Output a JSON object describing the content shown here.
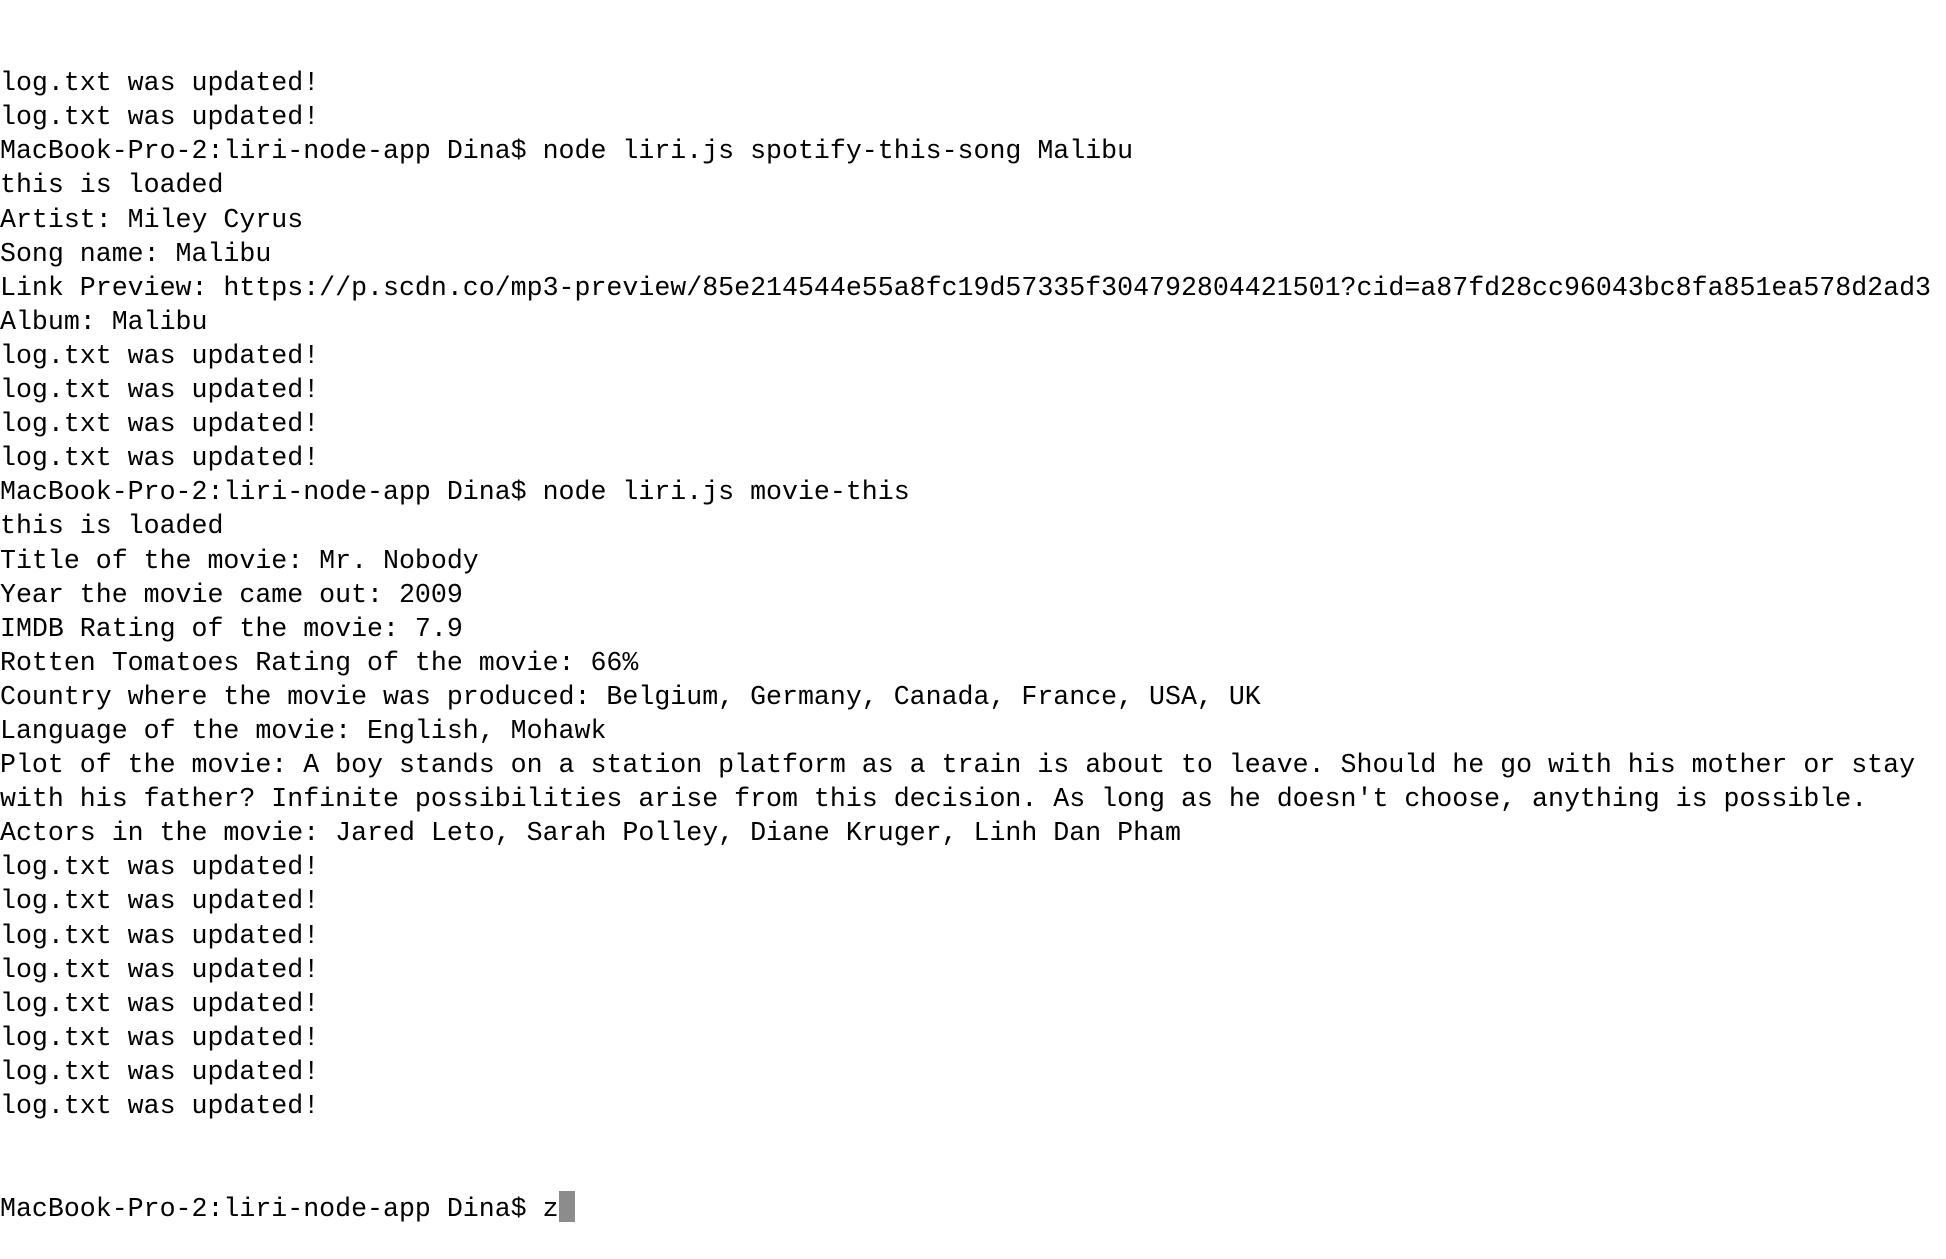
{
  "terminal": {
    "lines": [
      "log.txt was updated!",
      "log.txt was updated!",
      "MacBook-Pro-2:liri-node-app Dina$ node liri.js spotify-this-song Malibu",
      "this is loaded",
      "Artist: Miley Cyrus",
      "Song name: Malibu",
      "Link Preview: https://p.scdn.co/mp3-preview/85e214544e55a8fc19d57335f304792804421501?cid=a87fd28cc96043bc8fa851ea578d2ad3",
      "Album: Malibu",
      "log.txt was updated!",
      "log.txt was updated!",
      "log.txt was updated!",
      "log.txt was updated!",
      "MacBook-Pro-2:liri-node-app Dina$ node liri.js movie-this",
      "this is loaded",
      "Title of the movie: Mr. Nobody",
      "Year the movie came out: 2009",
      "IMDB Rating of the movie: 7.9",
      "Rotten Tomatoes Rating of the movie: 66%",
      "Country where the movie was produced: Belgium, Germany, Canada, France, USA, UK",
      "Language of the movie: English, Mohawk",
      "Plot of the movie: A boy stands on a station platform as a train is about to leave. Should he go with his mother or stay",
      "with his father? Infinite possibilities arise from this decision. As long as he doesn't choose, anything is possible.",
      "Actors in the movie: Jared Leto, Sarah Polley, Diane Kruger, Linh Dan Pham",
      "log.txt was updated!",
      "log.txt was updated!",
      "log.txt was updated!",
      "log.txt was updated!",
      "log.txt was updated!",
      "log.txt was updated!",
      "log.txt was updated!",
      "log.txt was updated!"
    ],
    "prompt": "MacBook-Pro-2:liri-node-app Dina$ ",
    "current_input": "z",
    "cursor_color": "#8c8c8c"
  }
}
